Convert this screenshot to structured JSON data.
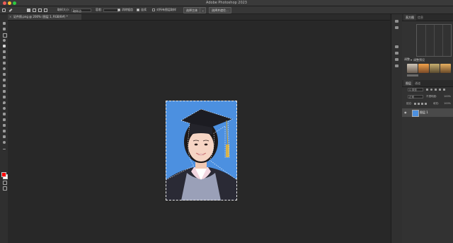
{
  "app": {
    "title": "Adobe Photoshop 2023"
  },
  "options_bar": {
    "size_label": "取样大小:",
    "size_value": "取样点",
    "tolerance_label": "容差:",
    "tolerance_value": "",
    "antialias_label": "消除锯齿",
    "contiguous_label": "连续",
    "all_layers_label": "对所有图层取样",
    "select_subject_label": "选择主体",
    "select_mask_label": "选择并遮住..."
  },
  "document_tab": {
    "title": "证件照.png @ 200% (图层 1, RGB/8#) *"
  },
  "panels": {
    "tabs": [
      "直方图",
      "信息"
    ],
    "adjustments_title": "调整",
    "presets_title": "调整预设",
    "layers_tabs": [
      "图层",
      "通道"
    ],
    "kind_label": "Q 类型",
    "blend_mode": "正常",
    "opacity_label": "不透明度:",
    "opacity_value": "100%",
    "lock_label": "锁定:",
    "fill_label": "填充:",
    "fill_value": "100%",
    "layer_name": "图层 1"
  },
  "colors": {
    "foreground": "#ff0000",
    "background": "#ffffff",
    "photo_background": "#4c90e0"
  }
}
